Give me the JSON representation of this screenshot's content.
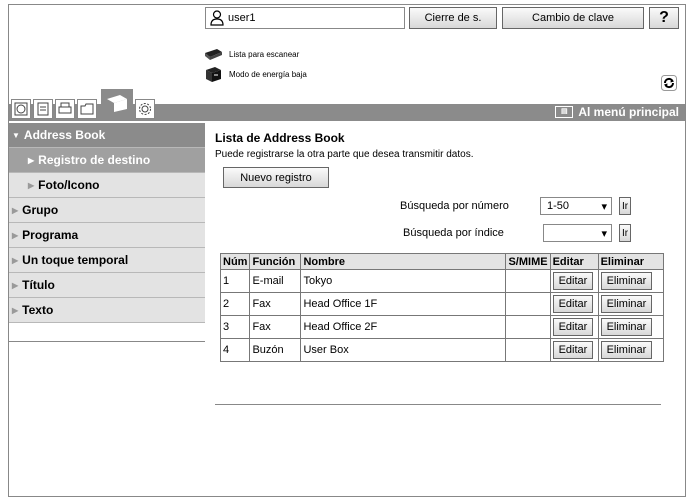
{
  "header": {
    "user_name": "user1",
    "logout_label": "Cierre de s.",
    "password_label": "Cambio de clave",
    "help_label": "?"
  },
  "status": {
    "scanner": "Lista para escanear",
    "energy": "Modo de energía baja"
  },
  "main_menu_label": "Al menú principal",
  "sidebar": {
    "items": [
      {
        "label": "Address Book"
      },
      {
        "label": "Registro de destino"
      },
      {
        "label": "Foto/Icono"
      },
      {
        "label": "Grupo"
      },
      {
        "label": "Programa"
      },
      {
        "label": "Un toque temporal"
      },
      {
        "label": "Título"
      },
      {
        "label": "Texto"
      }
    ]
  },
  "content": {
    "title": "Lista de Address Book",
    "description": "Puede registrarse la otra parte que desea transmitir datos.",
    "new_button": "Nuevo registro",
    "search_number_label": "Búsqueda por número",
    "search_number_value": "1-50",
    "search_index_label": "Búsqueda por índice",
    "search_index_value": "",
    "go_label": "Ir"
  },
  "table": {
    "headers": [
      "Núm",
      "Función",
      "Nombre",
      "S/MIME",
      "Editar",
      "Eliminar"
    ],
    "rows": [
      {
        "num": "1",
        "func": "E-mail",
        "name": "Tokyo",
        "smime": ""
      },
      {
        "num": "2",
        "func": "Fax",
        "name": "Head Office 1F",
        "smime": ""
      },
      {
        "num": "3",
        "func": "Fax",
        "name": "Head Office 2F",
        "smime": ""
      },
      {
        "num": "4",
        "func": "Buzón",
        "name": "User Box",
        "smime": ""
      }
    ],
    "edit_label": "Editar",
    "delete_label": "Eliminar"
  }
}
